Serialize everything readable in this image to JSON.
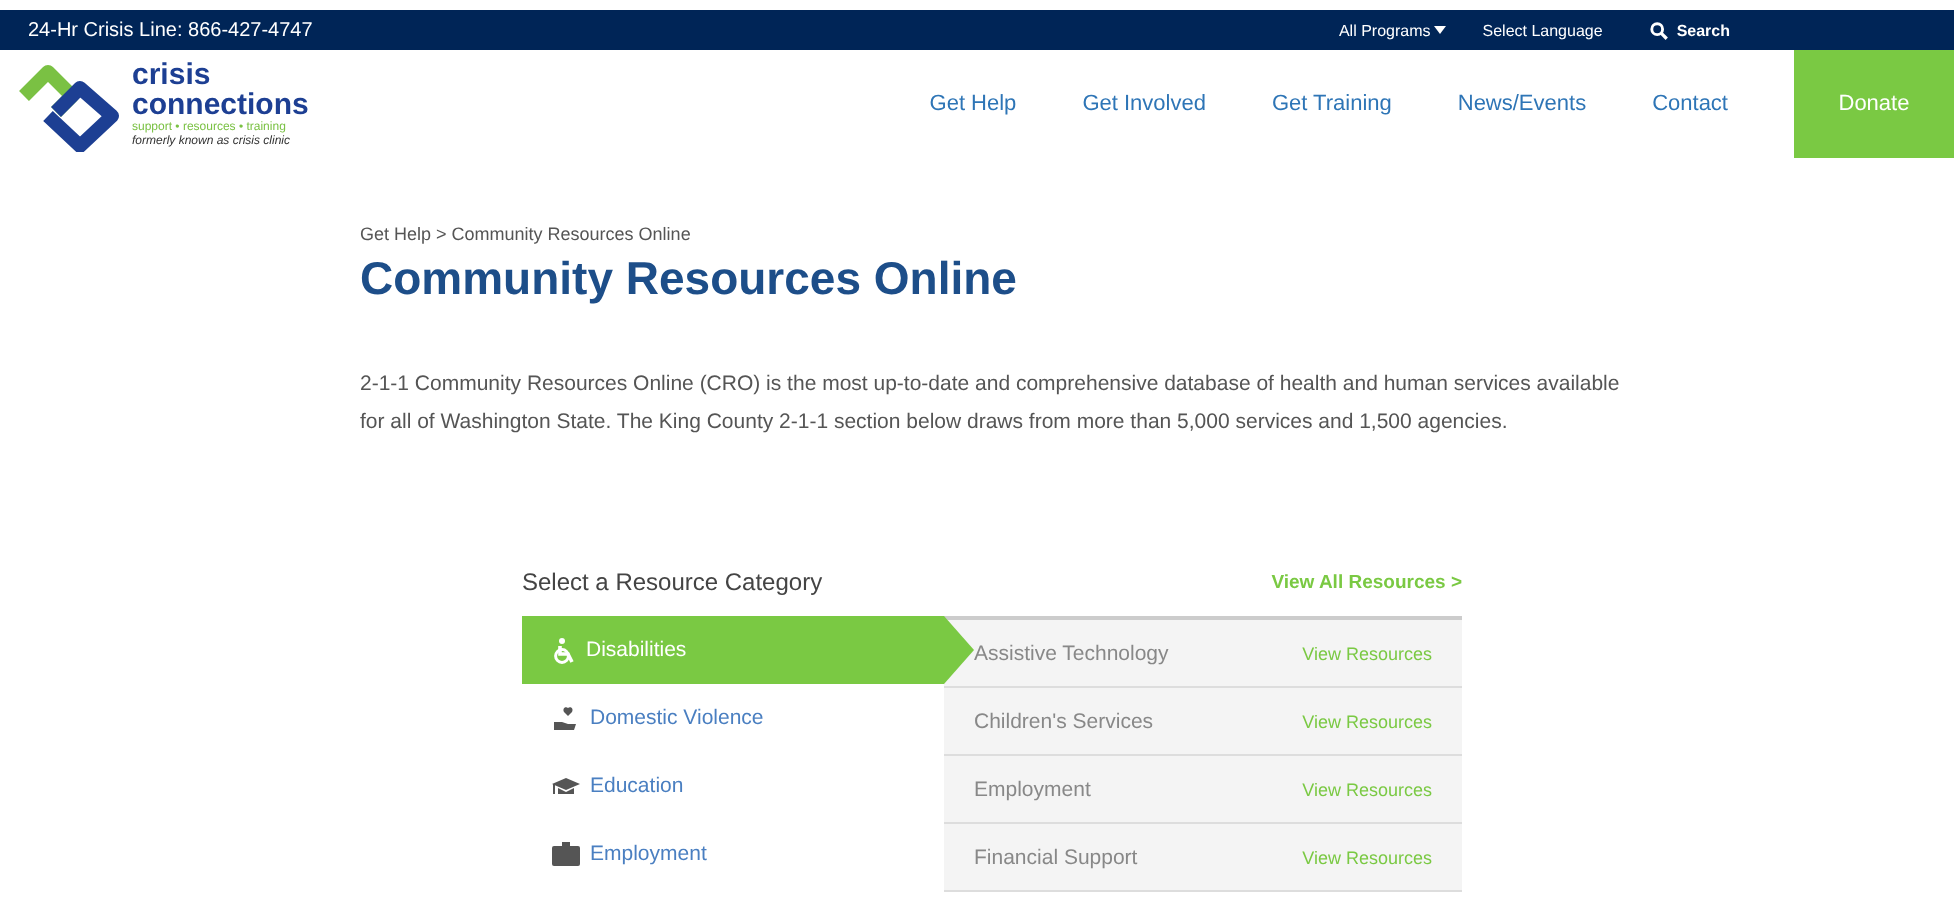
{
  "top_bar": {
    "crisis_line": "24-Hr Crisis Line: 866-427-4747",
    "links": [
      {
        "label": "All Programs",
        "dropdown": true
      },
      {
        "label": "Select Language",
        "dropdown": false
      }
    ],
    "search": "Search"
  },
  "header": {
    "logo": {
      "name_line_1": "crisis",
      "name_line_2": "connections",
      "tagline": "support • resources • training",
      "former_name": "formerly known as crisis clinic"
    },
    "nav": [
      "Get Help",
      "Get Involved",
      "Get Training",
      "News/Events",
      "Contact"
    ],
    "donate": "Donate"
  },
  "breadcrumb": "Get Help > Community Resources Online",
  "title": "Community Resources Online",
  "intro": "2-1-1 Community Resources Online (CRO) is the most up-to-date and comprehensive database of health and human services available for all of Washington State. The King County 2-1-1 section below draws from more than 5,000 services and 1,500 agencies.",
  "resources": {
    "heading": "Select a Resource Category",
    "view_all": "View All Resources >",
    "categories": [
      {
        "label": "Disabilities",
        "selected": true
      },
      {
        "label": "Domestic Violence",
        "selected": false
      },
      {
        "label": "Education",
        "selected": false
      },
      {
        "label": "Employment",
        "selected": false
      }
    ],
    "subcategories": [
      {
        "label": "Assistive Technology",
        "link": "View Resources"
      },
      {
        "label": "Children's Services",
        "link": "View Resources"
      },
      {
        "label": "Employment",
        "link": "View Resources"
      },
      {
        "label": "Financial Support",
        "link": "View Resources"
      }
    ]
  }
}
